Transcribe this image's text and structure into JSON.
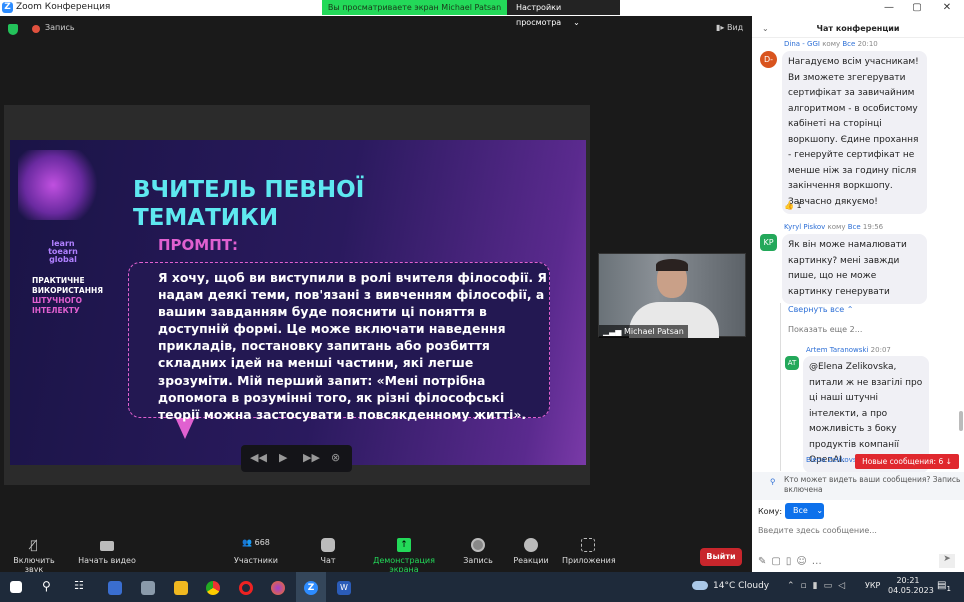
{
  "window": {
    "title": "Zoom Конференция",
    "banner": "Вы просматриваете экран Michael Patsan",
    "view_options": "Настройки просмотра"
  },
  "topbar": {
    "recording": "Запись",
    "view": "Вид"
  },
  "slide": {
    "title_line1": "ВЧИТЕЛЬ ПЕВНОЇ",
    "title_line2": "ТЕМАТИКИ",
    "prompt_label": "ПРОМПТ:",
    "logo_text": "learn toearn global",
    "side_line1": "ПРАКТИЧНЕ",
    "side_line2": "ВИКОРИСТАННЯ",
    "side_line3": "ШТУЧНОГО",
    "side_line4": "ІНТЕЛЕКТУ",
    "prompt_text": "Я хочу, щоб ви виступили в ролі вчителя філософії. Я надам деякі теми, пов'язані з вивченням філософії, а вашим завданням буде пояснити ці поняття в доступній формі. Це може включати наведення прикладів, постановку запитань або розбиття складних ідей на менші частини, які легше зрозуміти. Мій перший запит: «Мені потрібна допомога в розумінні того, як різні філософські теорії можна застосувати в повсякденному житті»."
  },
  "video": {
    "name": "Michael Patsan"
  },
  "chat": {
    "title": "Чат конференции",
    "messages": [
      {
        "sender": "Dina - GGI",
        "to_label": "кому",
        "to": "Все",
        "time": "20:10",
        "initials": "D-",
        "color": "#d9541e",
        "text": "Нагадуємо всім учасникам! Ви зможете згегерувати сертифікат за завичайним алгоритмом - в особистому кабінеті на сторінці воркшопу. Єдине прохання - генеруйте сертифікат не менше ніж за годину після закінчення воркшопу. Завчасно дякуємо!",
        "reaction": "👍",
        "reaction_count": "1"
      },
      {
        "sender": "Kyryl Piskov",
        "to_label": "кому",
        "to": "Все",
        "time": "19:56",
        "initials": "KP",
        "color": "#23a85a",
        "text": "Як він може намалювати картинку? мені завжди пише, що не може картинку генерувати"
      },
      {
        "sender": "Artem Taranowski",
        "time": "20:07",
        "initials": "AT",
        "color": "#23a85a",
        "text": "@Elena Zelikovska, питали ж не взагілі про ці наші штучні інтелекти, а про можливість з боку продуктів компанії OpenAI."
      },
      {
        "sender": "Elena Zelikovska"
      }
    ],
    "collapse_all": "Свернуть все ⌃",
    "show_more": "Показать еще 2...",
    "new_messages": "Новые сообщения: 6 ↓",
    "who_can_see": "Кто может видеть ваши сообщения? Запись включена",
    "to_label": "Кому:",
    "to_value": "Все",
    "input_placeholder": "Введите здесь сообщение..."
  },
  "toolbar": {
    "unmute": "Включить звук",
    "start_video": "Начать видео",
    "participants": "Участники",
    "participants_count": "668",
    "chat": "Чат",
    "share": "Демонстрация экрана",
    "record": "Запись",
    "reactions": "Реакции",
    "apps": "Приложения",
    "leave": "Выйти"
  },
  "taskbar": {
    "weather": "14°C  Cloudy",
    "lang": "УКР",
    "time": "20:21",
    "date": "04.05.2023",
    "notifications": "1"
  }
}
